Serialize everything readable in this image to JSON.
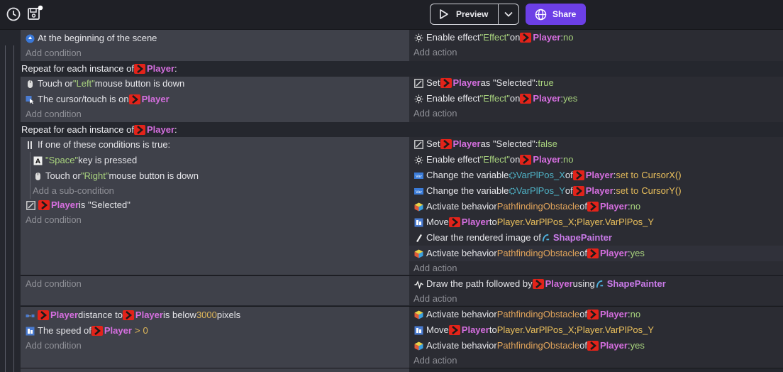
{
  "toolbar": {
    "history_icon": "history-clock-icon",
    "save_icon": "save-floppy-icon",
    "preview_label": "Preview",
    "share_label": "Share",
    "accent_color": "#6c3fe6"
  },
  "events": {
    "e1": {
      "cond1": "At the beginning of the scene",
      "add_condition": "Add condition",
      "act1": {
        "a": "Enable effect ",
        "b": "\"Effect\"",
        "c": " on ",
        "obj": "Player",
        "d": ": ",
        "val": "no"
      },
      "add_action": "Add action"
    },
    "e2": {
      "header": {
        "a": "Repeat for each instance of ",
        "obj": "Player",
        "b": " :"
      },
      "cond1": {
        "a": "Touch or ",
        "b": "\"Left\"",
        "c": " mouse button is down"
      },
      "cond2": {
        "a": "The cursor/touch is on ",
        "obj": "Player"
      },
      "add_condition": "Add condition",
      "act1": {
        "a": "Set ",
        "obj": "Player",
        "b": " as \"Selected\": ",
        "val": "true"
      },
      "act2": {
        "a": "Enable effect ",
        "b": "\"Effect\"",
        "c": " on ",
        "obj": "Player",
        "d": ": ",
        "val": "yes"
      },
      "add_action": "Add action"
    },
    "e3": {
      "header": {
        "a": "Repeat for each instance of ",
        "obj": "Player",
        "b": " :"
      },
      "or_label": "If one of these conditions is true:",
      "sub1": {
        "b": "\"Space\"",
        "c": " key is pressed"
      },
      "sub2": {
        "a": "Touch or ",
        "b": "\"Right\"",
        "c": " mouse button is down"
      },
      "add_sub": "Add a sub-condition",
      "cond2": {
        "obj": "Player",
        "b": " is \"Selected\""
      },
      "add_condition": "Add condition",
      "act1": {
        "a": "Set ",
        "obj": "Player",
        "b": " as \"Selected\": ",
        "val": "false"
      },
      "act2": {
        "a": "Enable effect ",
        "b": "\"Effect\"",
        "c": " on ",
        "obj": "Player",
        "d": ": ",
        "val": "no"
      },
      "act3": {
        "a": "Change the variable ",
        "var": "VarPlPos_X",
        "b": " of ",
        "obj": "Player",
        "c": ": ",
        "d": "set to",
        "expr": "CursorX()"
      },
      "act4": {
        "a": "Change the variable ",
        "var": "VarPlPos_Y",
        "b": " of ",
        "obj": "Player",
        "c": ": ",
        "d": "set to",
        "expr": "CursorY()"
      },
      "act5": {
        "a": "Activate behavior ",
        "beh": "PathfindingObstacle",
        "b": " of ",
        "obj": "Player",
        "c": ": ",
        "val": "no"
      },
      "act6": {
        "a": "Move ",
        "obj": "Player",
        "b": " to ",
        "expr": "Player.VarPlPos_X;Player.VarPlPos_Y"
      },
      "act7": {
        "a": "Clear the rendered image of ",
        "obj": "ShapePainter"
      },
      "act8": {
        "a": "Activate behavior ",
        "beh": "PathfindingObstacle",
        "b": " of ",
        "obj": "Player",
        "c": ": ",
        "val": "yes"
      },
      "add_action": "Add action"
    },
    "e4": {
      "add_condition": "Add condition",
      "act1": {
        "a": "Draw the path followed by ",
        "obj": "Player",
        "b": " using ",
        "obj2": "ShapePainter"
      },
      "add_action": "Add action"
    },
    "e5": {
      "cond1": {
        "obj": "Player",
        "a": " distance to ",
        "obj2": "Player",
        "b": " is below ",
        "num": "3000",
        "c": " pixels"
      },
      "cond2": {
        "a": "The speed of ",
        "obj": "Player",
        "op": ">",
        "num": "0"
      },
      "add_condition": "Add condition",
      "act1": {
        "a": "Activate behavior ",
        "beh": "PathfindingObstacle",
        "b": " of ",
        "obj": "Player",
        "c": ": ",
        "val": "no"
      },
      "act2": {
        "a": "Move ",
        "obj": "Player",
        "b": " to ",
        "expr": "Player.VarPlPos_X;Player.VarPlPos_Y"
      },
      "act3": {
        "a": "Activate behavior ",
        "beh": "PathfindingObstacle",
        "b": " of ",
        "obj": "Player",
        "c": ": ",
        "val": "yes"
      },
      "add_action": "Add action"
    }
  }
}
